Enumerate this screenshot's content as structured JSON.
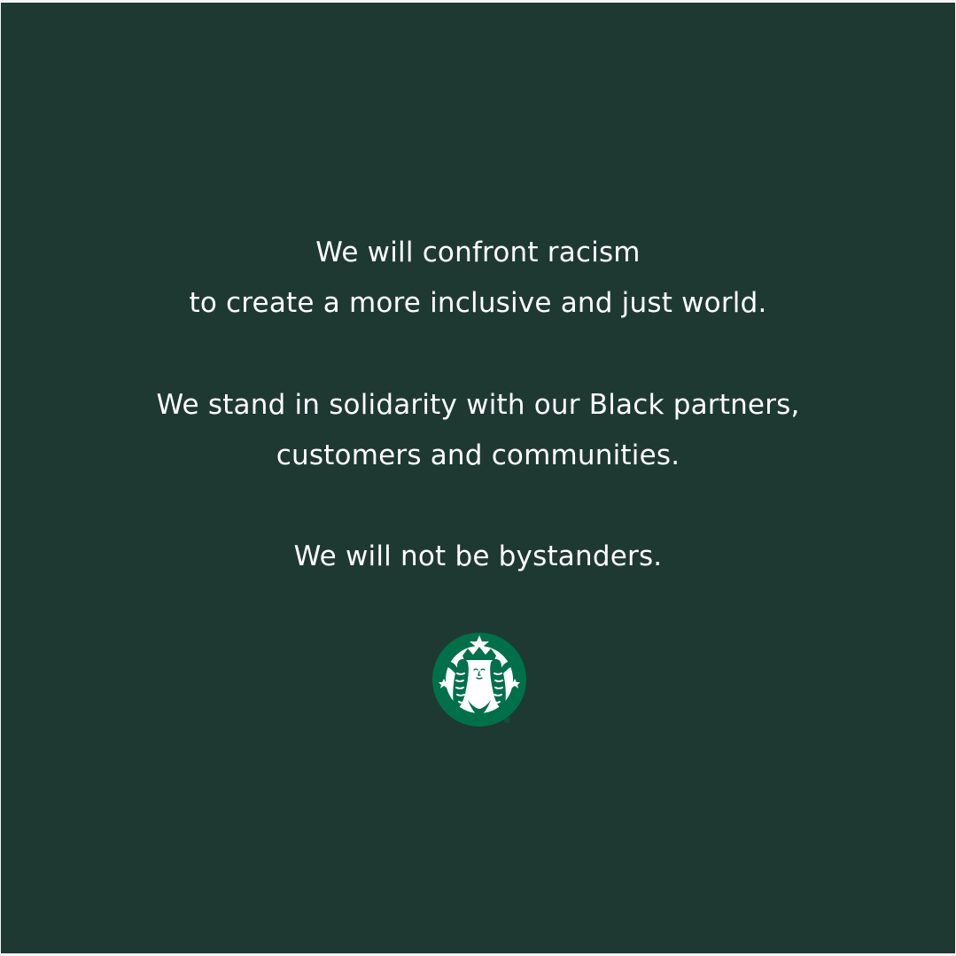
{
  "statement": {
    "line1": "We will confront racism",
    "line2": "to create a more inclusive and just world.",
    "line3": "We stand in solidarity with our Black partners,",
    "line4": "customers and communities.",
    "line5": "We will not be bystanders."
  },
  "logo": {
    "icon": "siren-logo-icon",
    "registered_mark": "®"
  },
  "colors": {
    "background": "#1e3932",
    "text": "#ffffff",
    "logo_green": "#00704a"
  }
}
